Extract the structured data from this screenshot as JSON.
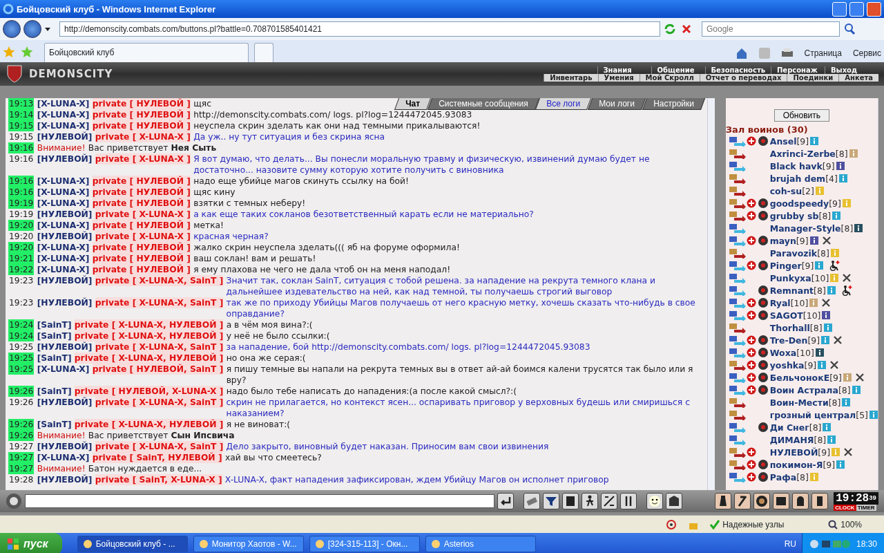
{
  "window": {
    "title": "Бойцовский клуб - Windows Internet Explorer"
  },
  "browser": {
    "address": "http://demonscity.combats.com/buttons.pl?battle=0.708701585401421",
    "search_placeholder": "Google",
    "tab": "Бойцовский клуб",
    "page_menu": "Страница",
    "tools_menu": "Сервис"
  },
  "game_header": {
    "logo": "DEMONSCITY",
    "menu_top": [
      "Знания",
      "Общение",
      "Безопасность",
      "Персонаж",
      "Выход"
    ],
    "menu_bottom": [
      "Инвентарь",
      "Умения",
      "Мой Скролл",
      "Отчет о переводах",
      "Поединки",
      "Анкета"
    ]
  },
  "chat_tabs": [
    {
      "label": "Чат",
      "selected": true,
      "link": false
    },
    {
      "label": "Системные сообщения",
      "selected": false,
      "link": false
    },
    {
      "label": "Все логи",
      "selected": false,
      "link": true
    },
    {
      "label": "Мои логи",
      "selected": false,
      "link": false
    },
    {
      "label": "Настройки",
      "selected": false,
      "link": false
    }
  ],
  "messages": [
    {
      "kind": "private",
      "time": "19:13",
      "highlighted": true,
      "own": false,
      "sender": "[X-LUNA-X]",
      "recipients": "private [ НУЛЕВОЙ ]",
      "text": "щяс"
    },
    {
      "kind": "private",
      "time": "19:14",
      "highlighted": true,
      "own": false,
      "sender": "[X-LUNA-X]",
      "recipients": "private [ НУЛЕВОЙ ]",
      "text": "http://demonscity.combats.com/ logs. pl?log=1244472045.93083"
    },
    {
      "kind": "private",
      "time": "19:15",
      "highlighted": true,
      "own": false,
      "sender": "[X-LUNA-X]",
      "recipients": "private [ НУЛЕВОЙ ]",
      "text": "неуспела скрин зделать как они над темными прикалываются!"
    },
    {
      "kind": "private",
      "time": "19:15",
      "highlighted": false,
      "own": true,
      "sender": "[НУЛЕВОЙ]",
      "recipients": "private [ X-LUNA-X ]",
      "text": "Да уж.. ну тут ситуация и без скрина ясна"
    },
    {
      "kind": "system",
      "time": "19:16",
      "highlighted": true,
      "label": "Внимание!",
      "text": "Вас приветствует **Нея Сыть**"
    },
    {
      "kind": "private",
      "time": "19:16",
      "highlighted": false,
      "own": true,
      "sender": "[НУЛЕВОЙ]",
      "recipients": "private [ X-LUNA-X ]",
      "text": "Я вот думаю, что делать... Вы понесли моральную травму и физическую, извинений думаю будет не достаточно... назовите сумму которую хотите получить с виновника"
    },
    {
      "kind": "private",
      "time": "19:16",
      "highlighted": true,
      "own": false,
      "sender": "[X-LUNA-X]",
      "recipients": "private [ НУЛЕВОЙ ]",
      "text": "надо еще убийце магов скинуть ссылку на бой!"
    },
    {
      "kind": "private",
      "time": "19:16",
      "highlighted": true,
      "own": false,
      "sender": "[X-LUNA-X]",
      "recipients": "private [ НУЛЕВОЙ ]",
      "text": "щяс кину"
    },
    {
      "kind": "private",
      "time": "19:19",
      "highlighted": true,
      "own": false,
      "sender": "[X-LUNA-X]",
      "recipients": "private [ НУЛЕВОЙ ]",
      "text": "взятки с темных неберу!"
    },
    {
      "kind": "private",
      "time": "19:19",
      "highlighted": false,
      "own": true,
      "sender": "[НУЛЕВОЙ]",
      "recipients": "private [ X-LUNA-X ]",
      "text": "а как еще таких сокланов безответственный карать если не материально?"
    },
    {
      "kind": "private",
      "time": "19:20",
      "highlighted": true,
      "own": false,
      "sender": "[X-LUNA-X]",
      "recipients": "private [ НУЛЕВОЙ ]",
      "text": "метка!"
    },
    {
      "kind": "private",
      "time": "19:20",
      "highlighted": false,
      "own": true,
      "sender": "[НУЛЕВОЙ]",
      "recipients": "private [ X-LUNA-X ]",
      "text": "красная черная?"
    },
    {
      "kind": "private",
      "time": "19:20",
      "highlighted": true,
      "own": false,
      "sender": "[X-LUNA-X]",
      "recipients": "private [ НУЛЕВОЙ ]",
      "text": "жалко скрин неуспела зделать((( яб на форуме оформила!"
    },
    {
      "kind": "private",
      "time": "19:21",
      "highlighted": true,
      "own": false,
      "sender": "[X-LUNA-X]",
      "recipients": "private [ НУЛЕВОЙ ]",
      "text": "ваш соклан! вам и решать!"
    },
    {
      "kind": "private",
      "time": "19:22",
      "highlighted": true,
      "own": false,
      "sender": "[X-LUNA-X]",
      "recipients": "private [ НУЛЕВОЙ ]",
      "text": "я ему плахова не чего не дала чтоб он на меня наподал!"
    },
    {
      "kind": "private",
      "time": "19:23",
      "highlighted": false,
      "own": true,
      "sender": "[НУЛЕВОЙ]",
      "recipients": "private [ X-LUNA-X, SainT ]",
      "text": "Значит так, соклан SainT, ситуация с тобой решена. за нападение на рекрута темного клана и дальнейшее издевательство на ней, как над темной, ты получаешь строгий выговор"
    },
    {
      "kind": "private",
      "time": "19:23",
      "highlighted": false,
      "own": true,
      "sender": "[НУЛЕВОЙ]",
      "recipients": "private [ X-LUNA-X, SainT ]",
      "text": "так же по приходу Убийцы Магов получаешь от него красную метку, хочешь сказать что-нибудь в свое оправдание?"
    },
    {
      "kind": "private",
      "time": "19:24",
      "highlighted": true,
      "own": false,
      "sender": "[SainT]",
      "recipients": "private [ X-LUNA-X, НУЛЕВОЙ ]",
      "text": "а в чём моя вина?:("
    },
    {
      "kind": "private",
      "time": "19:24",
      "highlighted": true,
      "own": false,
      "sender": "[SainT]",
      "recipients": "private [ X-LUNA-X, НУЛЕВОЙ ]",
      "text": "у неё не было ссылки:("
    },
    {
      "kind": "private",
      "time": "19:25",
      "highlighted": false,
      "own": true,
      "sender": "[НУЛЕВОЙ]",
      "recipients": "private [ X-LUNA-X, SainT ]",
      "text": "за нападение, бой http://demonscity.combats.com/ logs. pl?log=1244472045.93083"
    },
    {
      "kind": "private",
      "time": "19:25",
      "highlighted": true,
      "own": false,
      "sender": "[SainT]",
      "recipients": "private [ X-LUNA-X, НУЛЕВОЙ ]",
      "text": "но она же серая:("
    },
    {
      "kind": "private",
      "time": "19:25",
      "highlighted": true,
      "own": false,
      "sender": "[X-LUNA-X]",
      "recipients": "private [ НУЛЕВОЙ, SainT ]",
      "text": "я пишу темные вы напали на рекрута темных вы в ответ ай-ай боимся калени трусятся так было или я вру?"
    },
    {
      "kind": "private",
      "time": "19:26",
      "highlighted": true,
      "own": false,
      "sender": "[SainT]",
      "recipients": "private [ НУЛЕВОЙ, X-LUNA-X ]",
      "text": "надо было тебе написать до нападения:(а после какой смысл?:("
    },
    {
      "kind": "private",
      "time": "19:26",
      "highlighted": false,
      "own": true,
      "sender": "[НУЛЕВОЙ]",
      "recipients": "private [ X-LUNA-X, SainT ]",
      "text": "скрин не прилагается, но контекст ясен... оспаривать приговор у верховных будешь или смиришься с наказанием?"
    },
    {
      "kind": "private",
      "time": "19:26",
      "highlighted": true,
      "own": false,
      "sender": "[SainT]",
      "recipients": "private [ X-LUNA-X, НУЛЕВОЙ ]",
      "text": "я не виноват:("
    },
    {
      "kind": "system",
      "time": "19:26",
      "highlighted": true,
      "label": "Внимание!",
      "text": "Вас приветствует **Сын Ипсвича**"
    },
    {
      "kind": "private",
      "time": "19:27",
      "highlighted": false,
      "own": true,
      "sender": "[НУЛЕВОЙ]",
      "recipients": "private [ X-LUNA-X, SainT ]",
      "text": "Дело закрыто, виновный будет наказан. Приносим вам свои извинения"
    },
    {
      "kind": "private",
      "time": "19:27",
      "highlighted": true,
      "own": false,
      "sender": "[X-LUNA-X]",
      "recipients": "private [ SainT, НУЛЕВОЙ ]",
      "text": "хай вы что смеетесь?"
    },
    {
      "kind": "system",
      "time": "19:27",
      "highlighted": true,
      "label": "Внимание!",
      "text": "Батон нуждается в еде..."
    },
    {
      "kind": "private",
      "time": "19:28",
      "highlighted": false,
      "own": true,
      "sender": "[НУЛЕВОЙ]",
      "recipients": "private [ SainT, X-LUNA-X ]",
      "text": "X-LUNA-X, факт нападения зафиксирован, ждем Убийцу Магов он исполнет приговор"
    }
  ],
  "room": {
    "refresh_button": "Обновить",
    "title": "Зал воинов (30)",
    "users": [
      {
        "name": "Ansel",
        "level": "[9]",
        "kind": "blue",
        "cross": true,
        "emblem": true,
        "color": "#29a8d0",
        "muted": false,
        "injured": false
      },
      {
        "name": "Axrinci-Zerbe",
        "level": "[8]",
        "kind": "red",
        "cross": false,
        "emblem": false,
        "color": "#c8a878",
        "muted": false,
        "injured": false
      },
      {
        "name": "Black havk",
        "level": "[9]",
        "kind": "blue",
        "cross": false,
        "emblem": false,
        "color": "#5050a0",
        "muted": false,
        "injured": false
      },
      {
        "name": "brujah dem",
        "level": "[4]",
        "kind": "red",
        "cross": false,
        "emblem": false,
        "color": "#29a8d0",
        "muted": false,
        "injured": false
      },
      {
        "name": "coh-su",
        "level": "[2]",
        "kind": "red",
        "cross": false,
        "emblem": false,
        "color": "#e8c030",
        "muted": false,
        "injured": false
      },
      {
        "name": "goodspeedy",
        "level": "[9]",
        "kind": "red",
        "cross": true,
        "emblem": true,
        "color": "#e8c030",
        "muted": false,
        "injured": false
      },
      {
        "name": "grubby sb",
        "level": "[8]",
        "kind": "red",
        "cross": true,
        "emblem": true,
        "color": "#29a8d0",
        "muted": false,
        "injured": false
      },
      {
        "name": "Manager-Style",
        "level": "[8]",
        "kind": "blue",
        "cross": false,
        "emblem": false,
        "color": "#285060",
        "muted": false,
        "injured": false
      },
      {
        "name": "mayn",
        "level": "[9]",
        "kind": "blue",
        "cross": true,
        "emblem": true,
        "color": "#5050a0",
        "muted": true,
        "injured": false
      },
      {
        "name": "Paravozik",
        "level": "[8]",
        "kind": "red",
        "cross": false,
        "emblem": false,
        "color": "#e8c030",
        "muted": false,
        "injured": false
      },
      {
        "name": "Pinger",
        "level": "[9]",
        "kind": "blue",
        "cross": true,
        "emblem": true,
        "color": "#29a8d0",
        "muted": false,
        "injured": true
      },
      {
        "name": "Punkyxa",
        "level": "[10]",
        "kind": "blue",
        "cross": false,
        "emblem": false,
        "color": "#e8c030",
        "muted": true,
        "injured": false
      },
      {
        "name": "Remnant",
        "level": "[8]",
        "kind": "blue",
        "cross": false,
        "emblem": true,
        "color": "#29a8d0",
        "muted": false,
        "injured": true
      },
      {
        "name": "Ryal",
        "level": "[10]",
        "kind": "blue",
        "cross": true,
        "emblem": true,
        "color": "#c8a878",
        "muted": true,
        "injured": false
      },
      {
        "name": "SAGOT",
        "level": "[10]",
        "kind": "blue",
        "cross": true,
        "emblem": true,
        "color": "#5050a0",
        "muted": false,
        "injured": false
      },
      {
        "name": "Thorhall",
        "level": "[8]",
        "kind": "red",
        "cross": false,
        "emblem": false,
        "color": "#29a8d0",
        "muted": false,
        "injured": false
      },
      {
        "name": "Tre-Den",
        "level": "[9]",
        "kind": "blue",
        "cross": true,
        "emblem": true,
        "color": "#29a8d0",
        "muted": true,
        "injured": false
      },
      {
        "name": "Woxa",
        "level": "[10]",
        "kind": "blue",
        "cross": true,
        "emblem": true,
        "color": "#285060",
        "muted": false,
        "injured": false
      },
      {
        "name": "yoshka",
        "level": "[9]",
        "kind": "red",
        "cross": true,
        "emblem": true,
        "color": "#29a8d0",
        "muted": true,
        "injured": false
      },
      {
        "name": "БельчонокЕ",
        "level": "[9]",
        "kind": "blue",
        "cross": true,
        "emblem": true,
        "color": "#c8a878",
        "muted": true,
        "injured": false
      },
      {
        "name": "Воин Астрала",
        "level": "[8]",
        "kind": "blue",
        "cross": true,
        "emblem": true,
        "color": "#29a8d0",
        "muted": false,
        "injured": false
      },
      {
        "name": "Воин-Мести",
        "level": "[8]",
        "kind": "red",
        "cross": false,
        "emblem": false,
        "color": "#29a8d0",
        "muted": false,
        "injured": false
      },
      {
        "name": "грозный централ",
        "level": "[5]",
        "kind": "red",
        "cross": false,
        "emblem": false,
        "color": "#29a8d0",
        "muted": false,
        "injured": false
      },
      {
        "name": "Ди Снег",
        "level": "[8]",
        "kind": "blue",
        "cross": false,
        "emblem": true,
        "color": "#29a8d0",
        "muted": false,
        "injured": false
      },
      {
        "name": "ДИМАНЯ",
        "level": "[8]",
        "kind": "blue",
        "cross": false,
        "emblem": false,
        "color": "#29a8d0",
        "muted": false,
        "injured": false
      },
      {
        "name": "НУЛЕВОЙ",
        "level": "[9]",
        "kind": "red",
        "cross": true,
        "emblem": false,
        "color": "#e8c030",
        "muted": true,
        "injured": false
      },
      {
        "name": "покимон-Я",
        "level": "[9]",
        "kind": "red",
        "cross": true,
        "emblem": true,
        "color": "#29a8d0",
        "muted": false,
        "injured": false
      },
      {
        "name": "Рафа",
        "level": "[8]",
        "kind": "blue",
        "cross": true,
        "emblem": true,
        "color": "#e8c030",
        "muted": false,
        "injured": false
      }
    ]
  },
  "clock": {
    "time": "19:28",
    "seconds": "39",
    "clock_label": "CLOCK",
    "timer_label": "TIMER"
  },
  "status_bar": {
    "zone": "Надежные узлы",
    "zoom": "100%"
  },
  "taskbar": {
    "start": "пуск",
    "tasks": [
      {
        "label": "Бойцовский клуб - ...",
        "selected": true
      },
      {
        "label": "Монитор Хаотов - W...",
        "selected": false
      },
      {
        "label": "[324-315-113] - Окн...",
        "selected": false
      },
      {
        "label": "Asterios",
        "selected": false
      }
    ],
    "language": "RU",
    "time": "18:30"
  }
}
